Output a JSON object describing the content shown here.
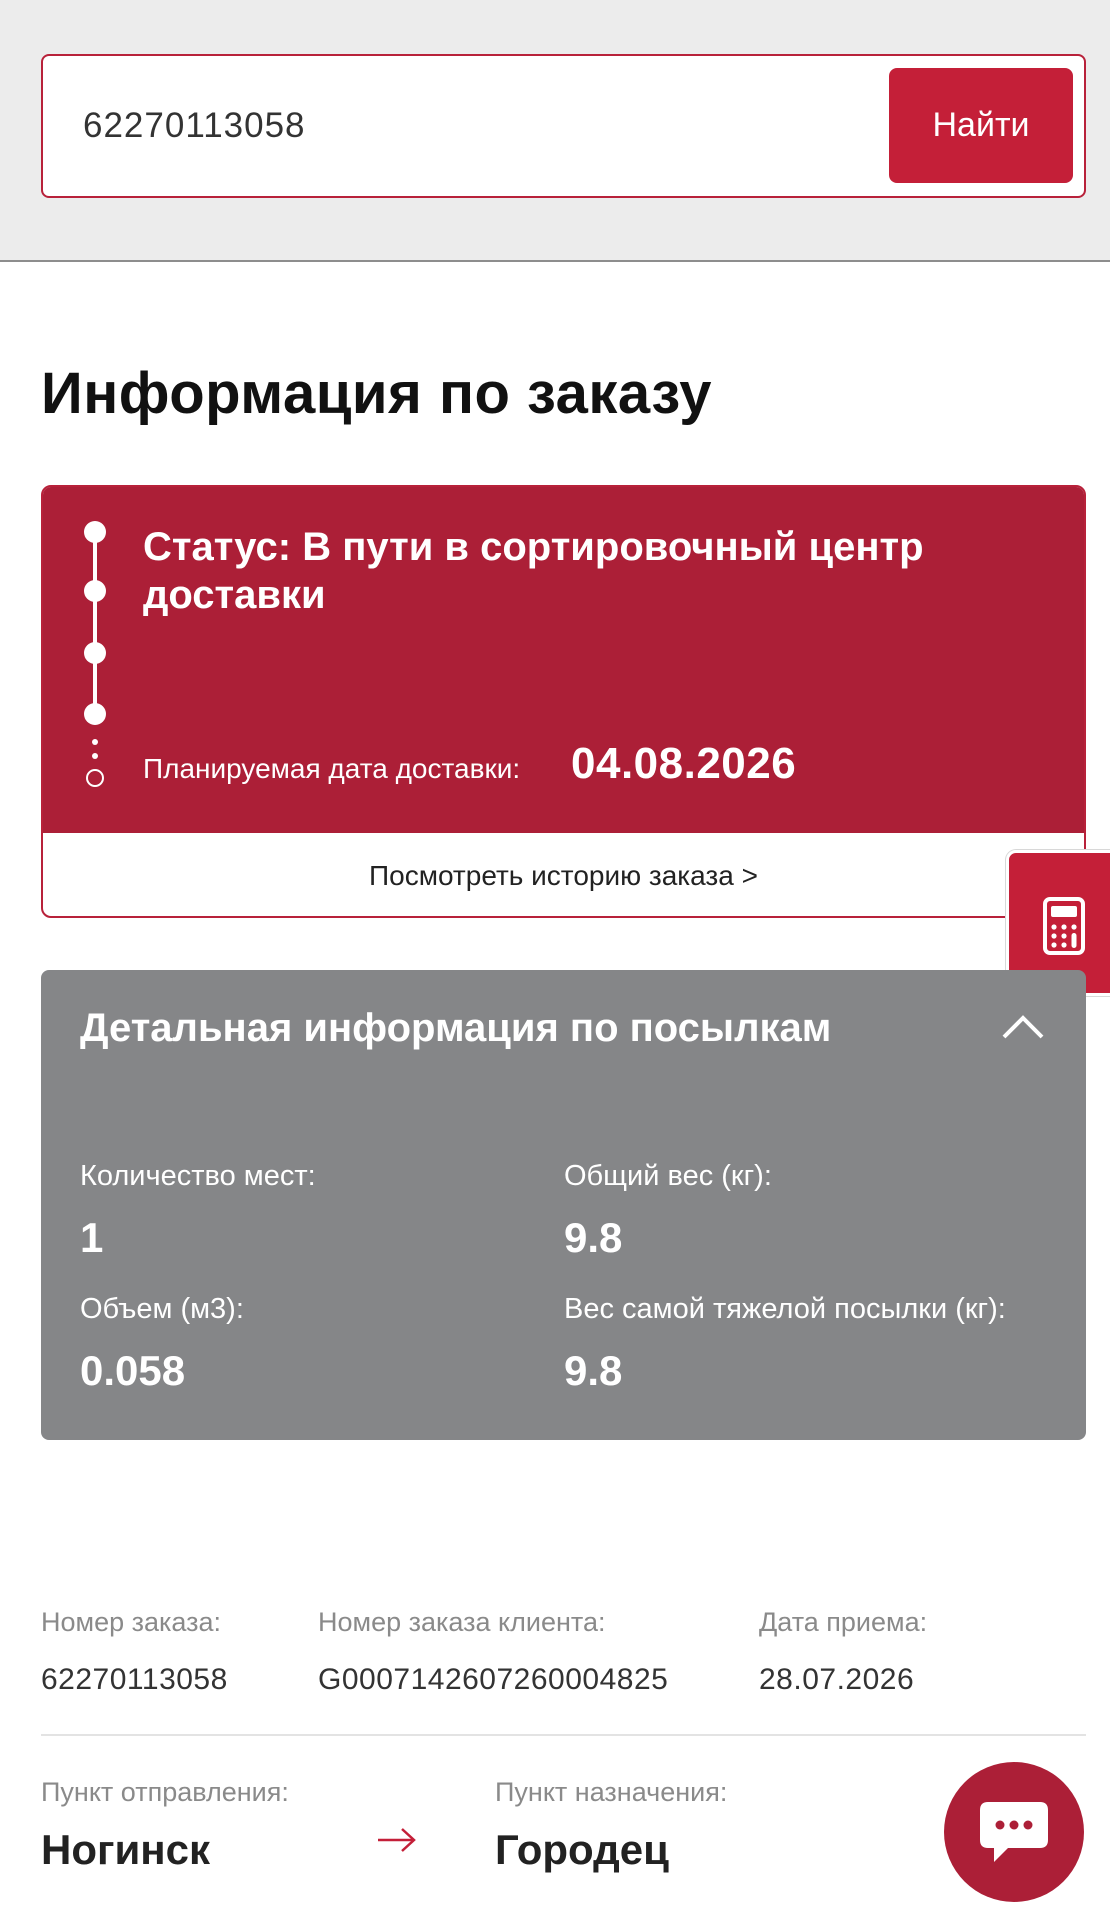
{
  "search": {
    "value": "62270113058",
    "button_label": "Найти"
  },
  "page": {
    "title": "Информация по заказу"
  },
  "status_card": {
    "status_text": "Статус: В пути в сортировочный центр доставки",
    "planned_label": "Планируемая дата доставки:",
    "planned_date": "04.08.2026",
    "history_link": "Посмотреть историю заказа >"
  },
  "details": {
    "title": "Детальная информация по посылкам",
    "places_label": "Количество мест:",
    "places_value": "1",
    "total_weight_label": "Общий вес (кг):",
    "total_weight_value": "9.8",
    "volume_label": "Объем (м3):",
    "volume_value": "0.058",
    "heaviest_label": "Вес самой тяжелой посылки (кг):",
    "heaviest_value": "9.8"
  },
  "order_info": {
    "order_number_label": "Номер заказа:",
    "order_number_value": "62270113058",
    "client_order_label": "Номер заказа клиента:",
    "client_order_value": "G0007142607260004825",
    "accept_date_label": "Дата приема:",
    "accept_date_value": "28.07.2026"
  },
  "route": {
    "from_label": "Пункт отправления:",
    "from_city": "Ногинск",
    "to_label": "Пункт назначения:",
    "to_city": "Городец"
  },
  "icons": {
    "calculator": "calculator-icon",
    "chat": "chat-icon",
    "chevron": "chevron-up-icon",
    "arrow": "arrow-right-icon"
  },
  "colors": {
    "brand_red": "#c41f38",
    "status_red": "#ac1f37",
    "details_gray": "#858688"
  }
}
